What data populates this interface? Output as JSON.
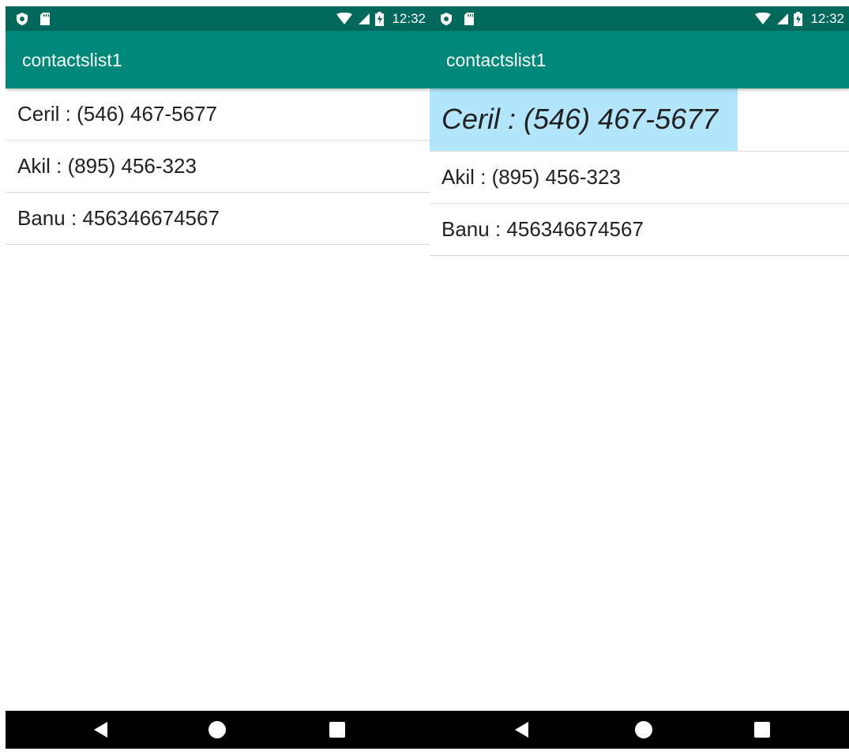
{
  "colors": {
    "status_bar": "#00695c",
    "app_bar": "#00897b",
    "highlight": "#b3e5fc",
    "nav_bar": "#000000",
    "divider": "#dcdcdc"
  },
  "icons": {
    "status_left": [
      "shield-icon",
      "sd-card-icon"
    ],
    "status_right": [
      "wifi-icon",
      "cell-signal-icon",
      "battery-charging-icon"
    ],
    "nav": [
      "back-icon",
      "home-icon",
      "recents-icon"
    ]
  },
  "screens": [
    {
      "status": {
        "time": "12:32"
      },
      "app_title": "contactslist1",
      "contacts": [
        {
          "text": "Ceril : (546) 467-5677"
        },
        {
          "text": "Akil : (895) 456-323"
        },
        {
          "text": "Banu : 456346674567"
        }
      ]
    },
    {
      "status": {
        "time": "12:32"
      },
      "app_title": "contactslist1",
      "contacts": [
        {
          "text": "Ceril : (546) 467-5677",
          "selected": true
        },
        {
          "text": "Akil : (895) 456-323"
        },
        {
          "text": "Banu : 456346674567"
        }
      ]
    }
  ]
}
